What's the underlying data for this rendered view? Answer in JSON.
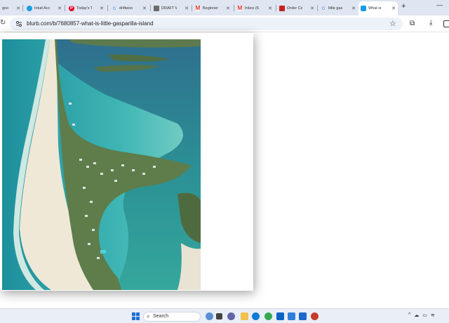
{
  "browser": {
    "tabs": [
      {
        "title": "goo",
        "favicon": "google-icon",
        "color": "#4285f4",
        "active": false
      },
      {
        "title": "Intuit Acc",
        "favicon": "intuit-icon",
        "color": "#2ca01c",
        "active": false
      },
      {
        "title": "Today's T",
        "favicon": "pinterest-icon",
        "color": "#e60023",
        "active": false
      },
      {
        "title": "driftwoo",
        "favicon": "google-icon",
        "color": "#4285f4",
        "active": false
      },
      {
        "title": "DRAFT W",
        "favicon": "doc-icon",
        "color": "#6b6b6b",
        "active": false
      },
      {
        "title": "Beginner",
        "favicon": "gmail-icon",
        "color": "#d93025",
        "active": false
      },
      {
        "title": "Inbox (6",
        "favicon": "gmail-icon",
        "color": "#d93025",
        "active": false
      },
      {
        "title": "Order Co",
        "favicon": "order-icon",
        "color": "#c5221f",
        "active": false
      },
      {
        "title": "little gas",
        "favicon": "google-icon",
        "color": "#4285f4",
        "active": false
      },
      {
        "title": "What is",
        "favicon": "blurb-icon",
        "color": "#1a9be6",
        "active": true
      }
    ],
    "new_tab_label": "+",
    "minimize_label": "—",
    "address": {
      "url": "blurb.com/b/7680857-what-is-little-gasparilla-island"
    },
    "accent": "#dfe5f1"
  },
  "page": {
    "photo": {
      "alt_subject": "aerial island photo"
    }
  },
  "taskbar": {
    "search_label": "Search",
    "apps": [
      {
        "name": "widgets-icon",
        "color": "#5a8fd8"
      },
      {
        "name": "file-explorer-icon",
        "color": "#f2c14e"
      },
      {
        "name": "task-view-icon",
        "color": "#444444"
      },
      {
        "name": "teams-icon",
        "color": "#6264a7"
      },
      {
        "name": "edge-icon",
        "color": "#0f7bd6"
      },
      {
        "name": "chrome-icon",
        "color": "#34a853"
      },
      {
        "name": "outlook-icon",
        "color": "#0a64c2"
      },
      {
        "name": "store-icon",
        "color": "#2f7fd8"
      },
      {
        "name": "mail-icon",
        "color": "#1b6ac9"
      },
      {
        "name": "photos-icon",
        "color": "#1d8ad6"
      },
      {
        "name": "chrome-profile-icon",
        "color": "#c53b2d"
      }
    ],
    "tray": [
      "^",
      "☁",
      "▭",
      "📶"
    ]
  }
}
